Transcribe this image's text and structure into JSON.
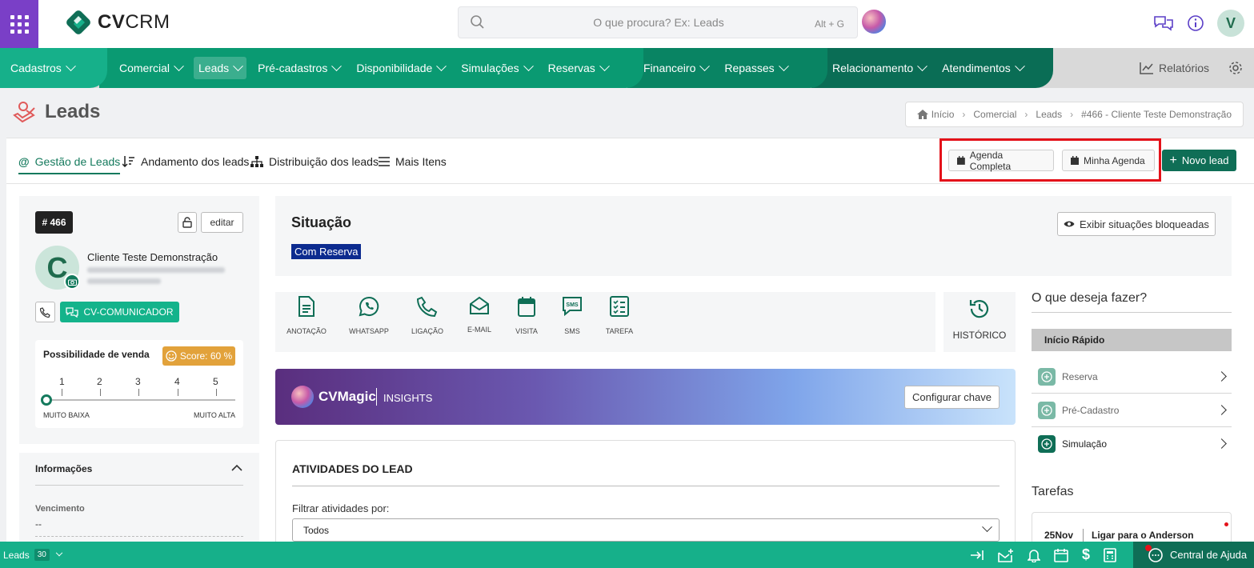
{
  "app": {
    "name_bold": "CV",
    "name_rest": "CRM"
  },
  "search": {
    "placeholder": "O que procura? Ex: Leads",
    "shortcut": "Alt + G"
  },
  "user": {
    "initial": "V"
  },
  "nav": {
    "cadastros": "Cadastros",
    "comercial": "Comercial",
    "leads": "Leads",
    "precadastros": "Pré-cadastros",
    "disponibilidade": "Disponibilidade",
    "simulacoes": "Simulações",
    "reservas": "Reservas",
    "financeiro": "Financeiro",
    "repasses": "Repasses",
    "relacionamento": "Relacionamento",
    "atendimentos": "Atendimentos",
    "relatorios": "Relatórios"
  },
  "page": {
    "title": "Leads"
  },
  "breadcrumb": {
    "home": "Início",
    "comercial": "Comercial",
    "leads": "Leads",
    "current": "#466 - Cliente Teste Demonstração"
  },
  "tabs": {
    "gestao": "Gestão de Leads",
    "andamento": "Andamento dos leads",
    "distribuicao": "Distribuição dos leads",
    "mais": "Mais Itens"
  },
  "actions": {
    "agenda_completa": "Agenda Completa",
    "minha_agenda": "Minha Agenda",
    "novo_lead": "Novo lead"
  },
  "lead": {
    "id": "# 466",
    "edit": "editar",
    "initial": "C",
    "name": "Cliente Teste Demonstração",
    "communicator": "CV-COMUNICADOR",
    "score_label": "Possibilidade de venda",
    "score_badge": "Score: 60 %",
    "scale": [
      "1",
      "2",
      "3",
      "4",
      "5"
    ],
    "scale_low": "MUITO BAIXA",
    "scale_high": "MUITO ALTA"
  },
  "info": {
    "title": "Informações",
    "vencimento_label": "Vencimento",
    "vencimento_value": "--"
  },
  "situacao": {
    "title": "Situação",
    "badge": "Com Reserva",
    "exibir": "Exibir situações bloqueadas"
  },
  "activity_types": {
    "anotacao": "ANOTAÇÃO",
    "whatsapp": "WHATSAPP",
    "ligacao": "LIGAÇÃO",
    "email": "E-MAIL",
    "visita": "VISITA",
    "sms": "SMS",
    "tarefa": "TAREFA",
    "historico": "HISTÓRICO"
  },
  "cvmagic": {
    "name": "CVMagic",
    "insights": "INSIGHTS",
    "configure": "Configurar chave"
  },
  "atividades": {
    "title": "ATIVIDADES DO LEAD",
    "filter_label": "Filtrar atividades por:",
    "filter_value": "Todos"
  },
  "quick": {
    "title": "O que deseja fazer?",
    "header": "Início Rápido",
    "reserva": "Reserva",
    "pre_cadastro": "Pré-Cadastro",
    "simulacao": "Simulação"
  },
  "tarefas": {
    "title": "Tarefas",
    "date": "25Nov",
    "text": "Ligar para o Anderson"
  },
  "footer": {
    "label": "Leads",
    "count": "30",
    "help": "Central de Ajuda"
  },
  "colors": {
    "brand_green": "#16b08a",
    "dark_green": "#0f6e56",
    "purple": "#7a3fc7",
    "highlight": "#e4121a",
    "score": "#e2a23b"
  }
}
